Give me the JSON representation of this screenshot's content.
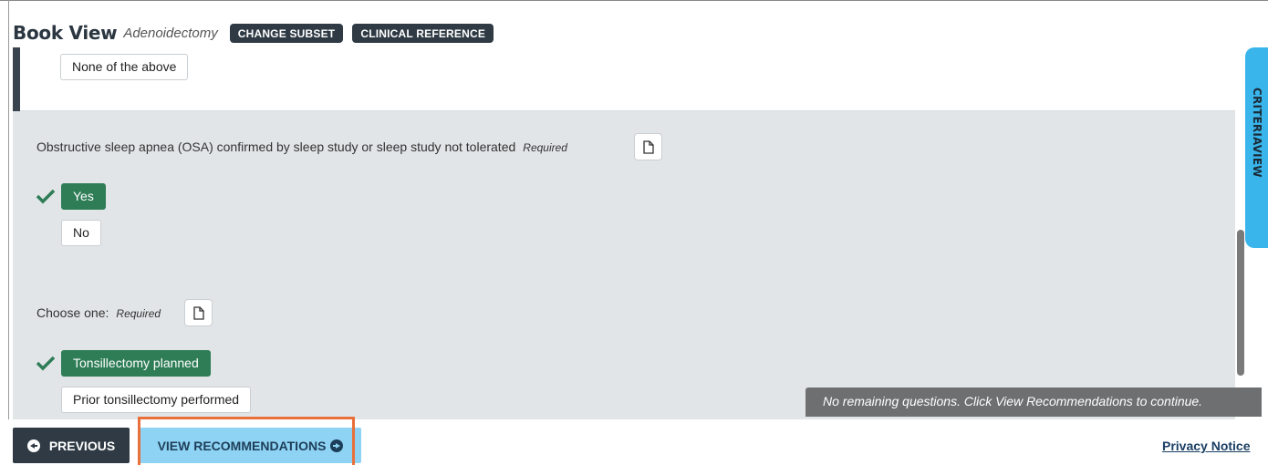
{
  "header": {
    "title": "Book View",
    "subtitle": "Adenoidectomy",
    "change_subset": "CHANGE SUBSET",
    "clinical_reference": "CLINICAL REFERENCE"
  },
  "prev_section": {
    "option": "None of the above"
  },
  "questions": [
    {
      "text": "Obstructive sleep apnea (OSA) confirmed by sleep study or sleep study not tolerated",
      "required": "Required",
      "options": [
        {
          "label": "Yes",
          "selected": true
        },
        {
          "label": "No",
          "selected": false
        }
      ]
    },
    {
      "text": "Choose one:",
      "required": "Required",
      "options": [
        {
          "label": "Tonsillectomy planned",
          "selected": true
        },
        {
          "label": "Prior tonsillectomy performed",
          "selected": false
        }
      ]
    }
  ],
  "toast": "No remaining questions. Click View Recommendations to continue.",
  "side_tab": "CRITERIAVIEW",
  "footer": {
    "previous": "PREVIOUS",
    "view_recommendations": "VIEW RECOMMENDATIONS",
    "privacy": "Privacy Notice"
  },
  "icons": {
    "check": "check-icon",
    "document": "document-icon",
    "prev": "arrow-left-circle-icon",
    "next": "arrow-right-circle-icon"
  },
  "colors": {
    "selected_green": "#2e7d57",
    "dark": "#2f3a44",
    "accent_blue": "#39b5ec",
    "highlight": "#e8703a"
  }
}
